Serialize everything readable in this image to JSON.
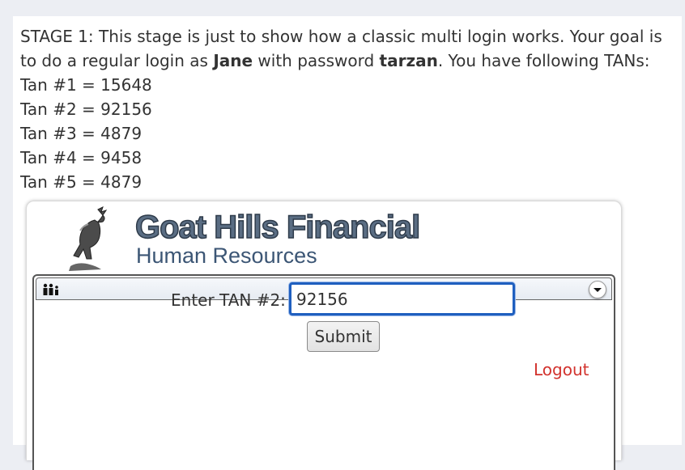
{
  "intro": {
    "text_1": "STAGE 1: This stage is just to show how a classic multi login works. Your goal is to do a regular login as ",
    "user": "Jane",
    "text_2": " with password ",
    "password": "tarzan",
    "text_3": ". You have following TANs:",
    "tans": [
      "Tan #1 = 15648",
      "Tan #2 = 92156",
      "Tan #3 = 4879",
      "Tan #4 = 9458",
      "Tan #5 = 4879"
    ]
  },
  "header": {
    "title": "Goat Hills Financial",
    "subtitle": "Human Resources"
  },
  "form": {
    "tan_label": "Enter TAN #2:",
    "tan_value": "92156",
    "submit_label": "Submit",
    "logout_label": "Logout"
  },
  "icons": {
    "people": "people-icon",
    "dropdown": "chevron-down-icon"
  },
  "colors": {
    "input_focus": "#1f5fbf",
    "logout": "#d2322d"
  }
}
